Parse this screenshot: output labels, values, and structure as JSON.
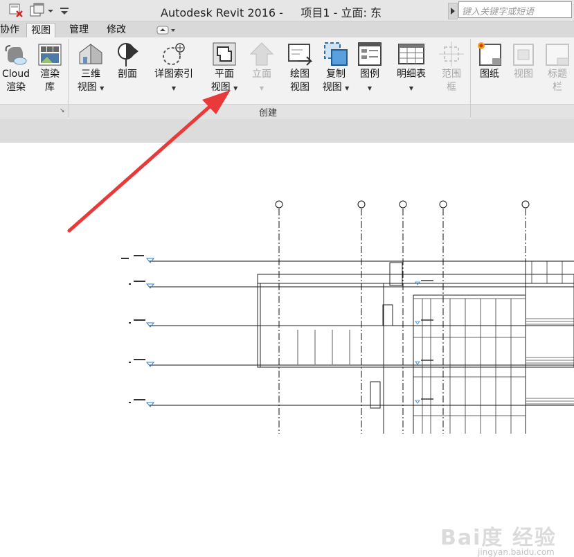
{
  "titlebar": {
    "title": "Autodesk Revit 2016 -     项目1 - 立面: 东",
    "search_placeholder": "键入关键字或短语",
    "qat_icons": [
      "close-project-icon",
      "switch-window-icon",
      "dropdown-icon"
    ]
  },
  "tabs": [
    {
      "label": "协作",
      "active": false
    },
    {
      "label": "视图",
      "active": true
    },
    {
      "label": "管理",
      "active": false
    },
    {
      "label": "修改",
      "active": false
    }
  ],
  "ribbon": {
    "render_panel": {
      "buttons": [
        {
          "line1": "Cloud",
          "line2": "渲染",
          "icon": "cloud-render-icon"
        },
        {
          "line1": "渲染",
          "line2": "库",
          "icon": "render-gallery-icon"
        }
      ]
    },
    "create_panel": {
      "title": "创建",
      "buttons": [
        {
          "line1": "三维",
          "line2": "视图",
          "icon": "3d-view-icon",
          "disabled": false
        },
        {
          "line1": "剖面",
          "line2": "",
          "icon": "section-icon",
          "disabled": false
        },
        {
          "line1": "详图索引",
          "line2": "",
          "icon": "callout-icon",
          "disabled": false
        },
        {
          "line1": "平面",
          "line2": "视图",
          "icon": "plan-view-icon",
          "disabled": false
        },
        {
          "line1": "立面",
          "line2": "",
          "icon": "elevation-icon",
          "disabled": true
        },
        {
          "line1": "绘图",
          "line2": "视图",
          "icon": "drafting-view-icon",
          "disabled": false
        },
        {
          "line1": "复制",
          "line2": "视图",
          "icon": "duplicate-view-icon",
          "disabled": false
        },
        {
          "line1": "图例",
          "line2": "",
          "icon": "legend-icon",
          "disabled": false
        },
        {
          "line1": "明细表",
          "line2": "",
          "icon": "schedule-icon",
          "disabled": false
        },
        {
          "line1": "范围",
          "line2": "框",
          "icon": "scope-box-icon",
          "disabled": true
        }
      ]
    },
    "sheet_panel": {
      "buttons": [
        {
          "line1": "图纸",
          "line2": "",
          "icon": "sheet-icon",
          "disabled": false
        },
        {
          "line1": "视图",
          "line2": "",
          "icon": "place-view-icon",
          "disabled": true
        },
        {
          "line1": "标题",
          "line2": "栏",
          "icon": "title-block-icon",
          "disabled": true
        }
      ]
    }
  },
  "drawing": {
    "grid_bubbles": 5,
    "level_marks": 5
  },
  "watermark": {
    "brand": "Bai度 经验",
    "sub": "jingyan.baidu.com"
  },
  "colors": {
    "annotation_arrow": "#e83a3a",
    "level_triangle": "#2b7fd1"
  }
}
